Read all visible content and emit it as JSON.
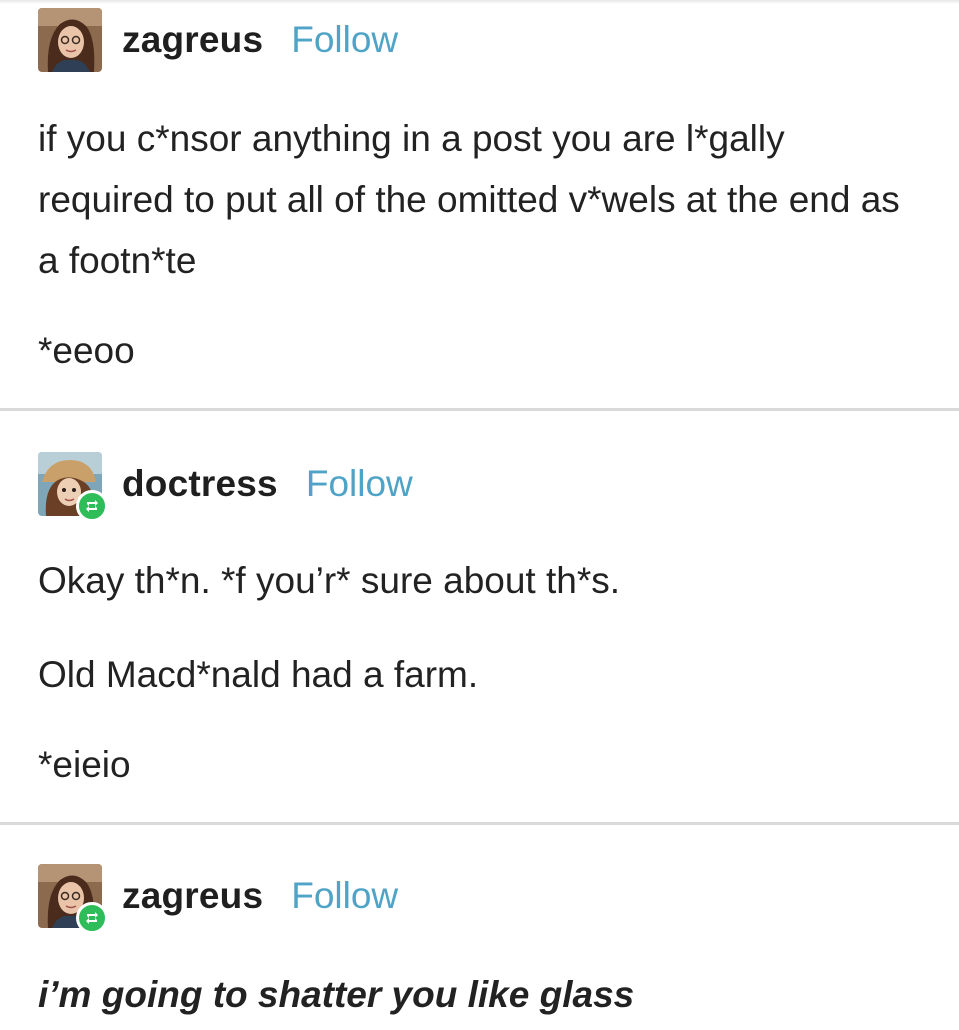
{
  "posts": [
    {
      "username": "zagreus",
      "follow_label": "Follow",
      "reblogged": false,
      "paragraphs": [
        "if you c*nsor anything in a post you are l*gally required to put all of the omitted v*wels at the end as a footn*te",
        "*eeoo"
      ]
    },
    {
      "username": "doctress",
      "follow_label": "Follow",
      "reblogged": true,
      "paragraphs": [
        "Okay th*n. *f you’r* sure about th*s.",
        "Old Macd*nald had a farm.",
        "*eieio"
      ]
    },
    {
      "username": "zagreus",
      "follow_label": "Follow",
      "reblogged": true,
      "paragraphs": [
        "i’m going to shatter you like glass"
      ]
    }
  ],
  "colors": {
    "follow": "#4fa3c7",
    "reblog_badge": "#2ebd59",
    "divider": "#d9d9d9"
  },
  "icons": {
    "reblog": "reblog-icon",
    "avatar": "avatar"
  }
}
